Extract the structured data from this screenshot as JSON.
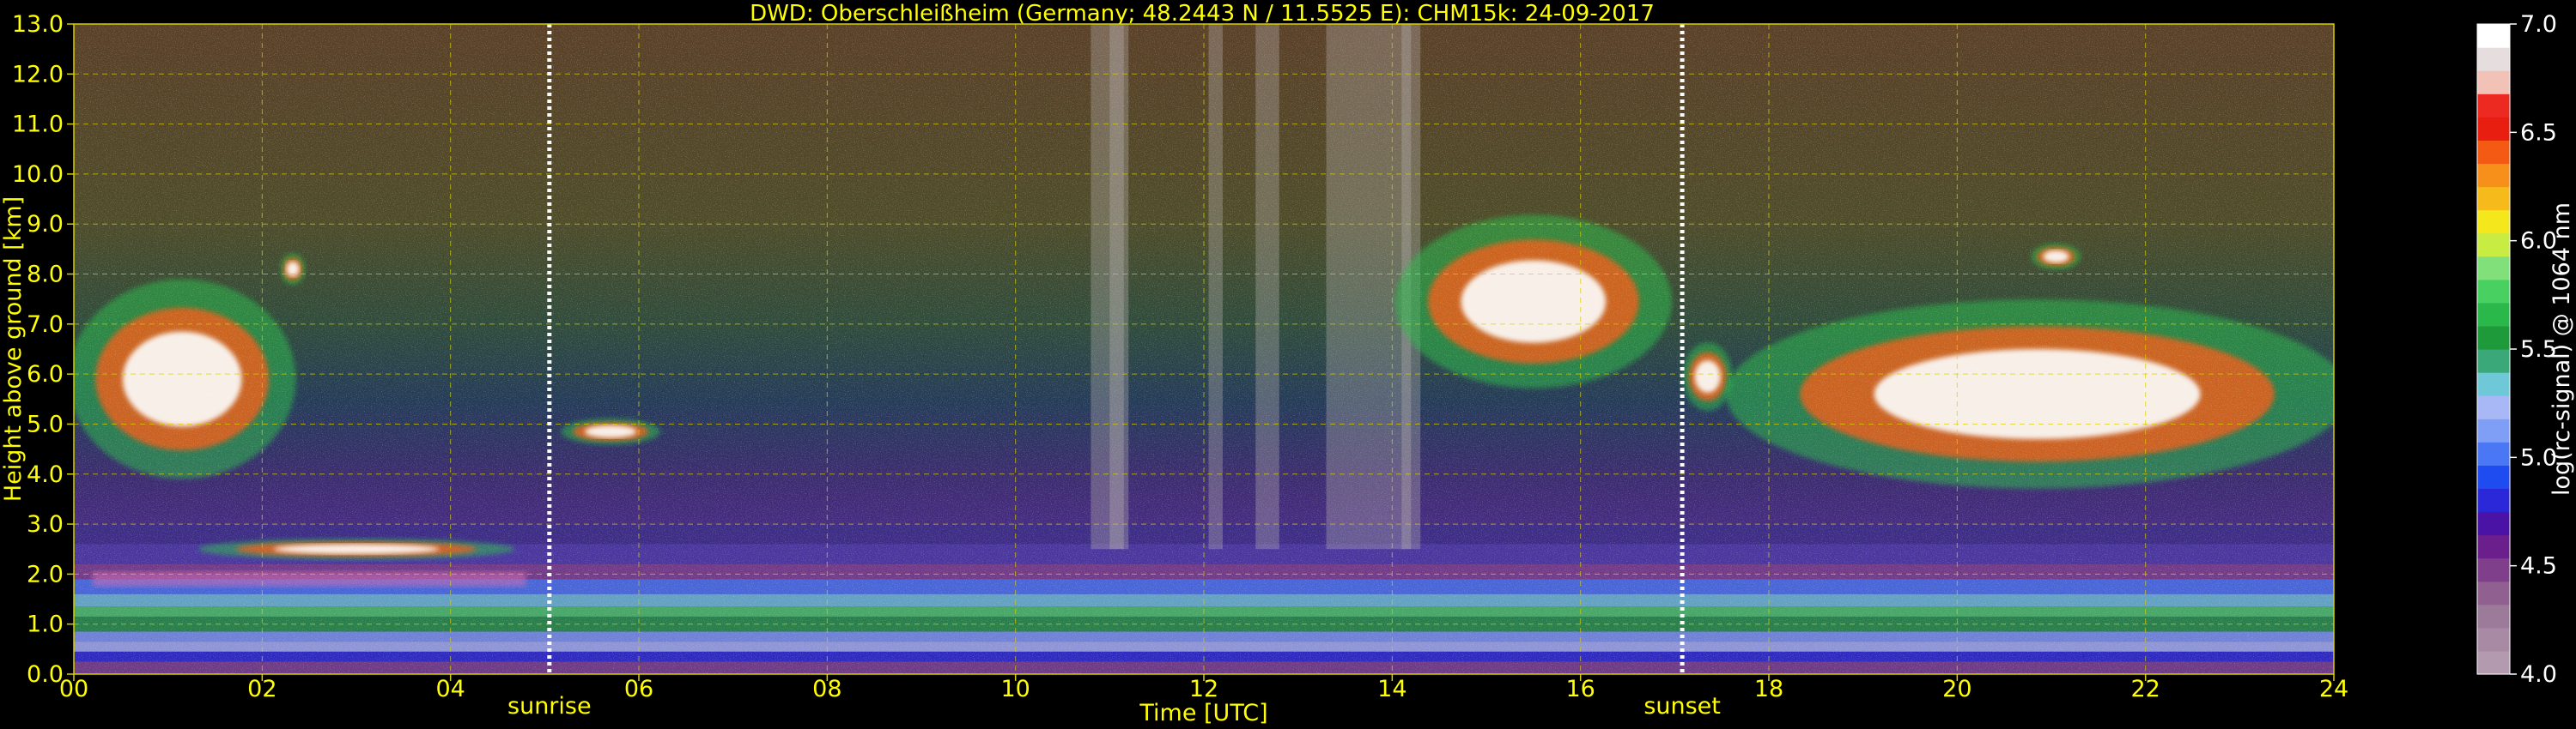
{
  "title": "DWD: Oberschleißheim (Germany; 48.2443 N / 11.5525 E):    CHM15k: 24-09-2017",
  "chart_data": {
    "type": "heatmap",
    "title": "DWD: Oberschleißheim (Germany; 48.2443 N / 11.5525 E):    CHM15k: 24-09-2017",
    "xlabel": "Time [UTC]",
    "ylabel": "Height above ground [km]",
    "xlim": [
      0,
      24
    ],
    "ylim": [
      0,
      13
    ],
    "x_ticks": [
      "00",
      "02",
      "04",
      "06",
      "08",
      "10",
      "12",
      "14",
      "16",
      "18",
      "20",
      "22",
      "24"
    ],
    "y_ticks": [
      "0.0",
      "1.0",
      "2.0",
      "3.0",
      "4.0",
      "5.0",
      "6.0",
      "7.0",
      "8.0",
      "9.0",
      "10.0",
      "11.0",
      "12.0",
      "13.0"
    ],
    "grid": true,
    "grid_style": "dashed",
    "markers": [
      {
        "label": "sunrise",
        "time": 5.05
      },
      {
        "label": "sunset",
        "time": 17.08
      }
    ],
    "colorbar": {
      "label": "log(rc-signal) @ 1064 nm",
      "range": [
        4.0,
        7.0
      ],
      "ticks": [
        "4.0",
        "4.5",
        "5.0",
        "5.5",
        "6.0",
        "6.5",
        "7.0"
      ],
      "colors": [
        "#b39aae",
        "#a88aa4",
        "#9c7a9a",
        "#8f6090",
        "#7f3f8a",
        "#6a1f8c",
        "#4b12a6",
        "#2a28d8",
        "#1f4cf0",
        "#4a78f4",
        "#7f9ef6",
        "#a8b8f6",
        "#6ec8d8",
        "#3aa878",
        "#1f9a3a",
        "#2bb84a",
        "#48d060",
        "#82e07a",
        "#c8ec42",
        "#f4e81c",
        "#f6bb1a",
        "#f6901a",
        "#f45a14",
        "#e81e10",
        "#ec2a22",
        "#f2c2b6",
        "#e6dede",
        "#ffffff"
      ]
    },
    "features": [
      {
        "description_label": "cloud",
        "t_start": 0.0,
        "t_end": 2.3,
        "base_km": 4.0,
        "top_km": 7.8
      },
      {
        "description_label": "cloud",
        "t_start": 2.2,
        "t_end": 2.45,
        "base_km": 7.8,
        "top_km": 8.4
      },
      {
        "description_label": "cloud",
        "t_start": 1.4,
        "t_end": 4.6,
        "base_km": 2.3,
        "top_km": 2.7
      },
      {
        "description_label": "cloud",
        "t_start": 5.2,
        "t_end": 6.2,
        "base_km": 4.6,
        "top_km": 5.1
      },
      {
        "description_label": "cloud",
        "t_start": 14.1,
        "t_end": 16.9,
        "base_km": 5.8,
        "top_km": 9.1
      },
      {
        "description_label": "cloud",
        "t_start": 17.1,
        "t_end": 17.6,
        "base_km": 5.3,
        "top_km": 6.6
      },
      {
        "description_label": "cloud",
        "t_start": 17.7,
        "t_end": 24.0,
        "base_km": 3.8,
        "top_km": 7.4
      },
      {
        "description_label": "cloud",
        "t_start": 20.8,
        "t_end": 21.3,
        "base_km": 8.1,
        "top_km": 8.6
      }
    ]
  }
}
